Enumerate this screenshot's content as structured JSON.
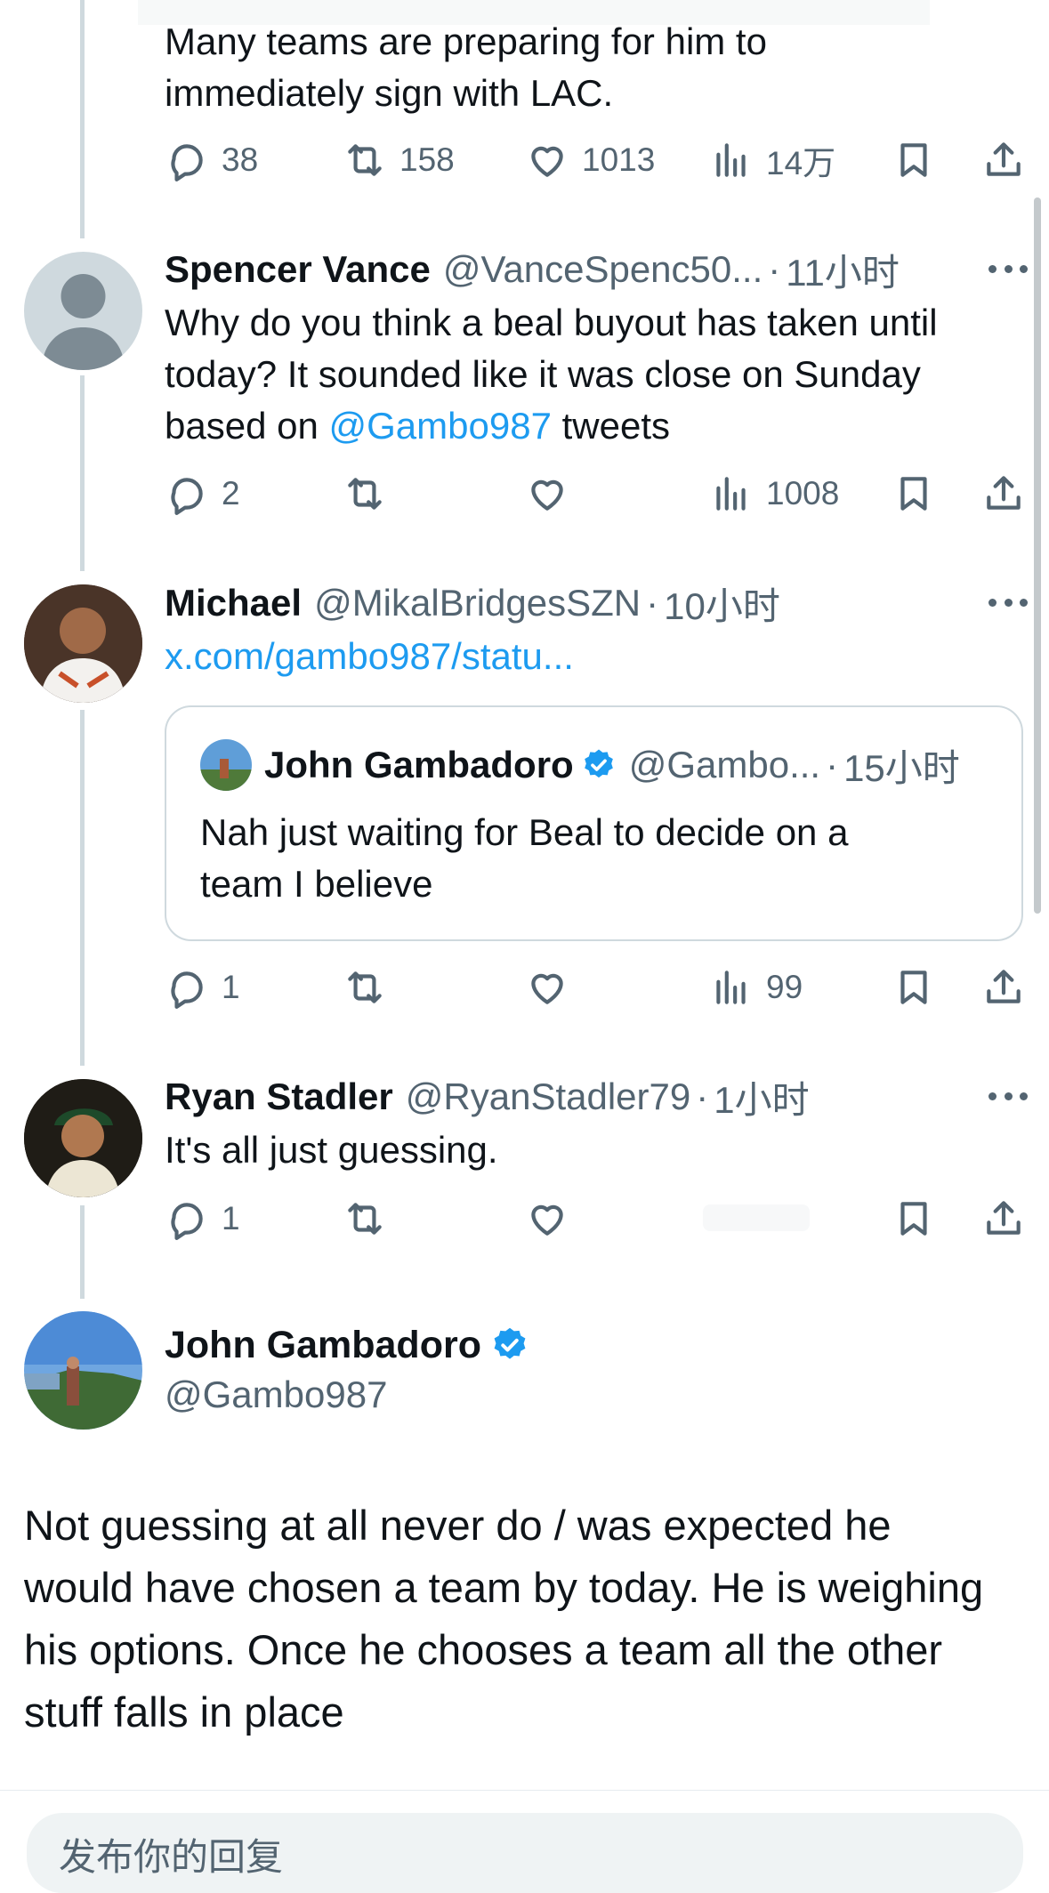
{
  "tweets": {
    "top": {
      "text_line1": "Many teams are preparing for him to",
      "text_line2": "immediately sign with LAC.",
      "stats": {
        "replies": "38",
        "retweets": "158",
        "likes": "1013",
        "views": "14万"
      }
    },
    "spencer": {
      "name": "Spencer Vance",
      "handle": "@VanceSpenc50...",
      "time": "11小时",
      "text_before": "Why do you think a beal buyout has taken until today? It sounded like it was close on Sunday based on ",
      "mention": "@Gambo987",
      "text_after": " tweets",
      "stats": {
        "replies": "2",
        "retweets": "",
        "likes": "",
        "views": "1008"
      }
    },
    "michael": {
      "name": "Michael",
      "handle": "@MikalBridgesSZN",
      "time": "10小时",
      "link": "x.com/gambo987/statu...",
      "quote": {
        "name": "John Gambadoro",
        "handle": "@Gambo...",
        "time": "15小时",
        "text": "Nah just waiting for Beal to decide on a team I believe"
      },
      "stats": {
        "replies": "1",
        "retweets": "",
        "likes": "",
        "views": "99"
      }
    },
    "ryan": {
      "name": "Ryan Stadler",
      "handle": "@RyanStadler79",
      "time": "1小时",
      "text": "It's all just guessing.",
      "stats": {
        "replies": "1",
        "retweets": "",
        "likes": ""
      }
    },
    "main": {
      "name": "John Gambadoro",
      "handle": "@Gambo987",
      "text": "Not guessing at all never do / was expected he would have chosen a team by today. He is weighing his options. Once he chooses a team all the other stuff falls in place"
    }
  },
  "reply_box": {
    "placeholder": "发布你的回复"
  },
  "colors": {
    "accent": "#1d9bf0",
    "muted": "#536471",
    "line": "#cfd9de"
  }
}
